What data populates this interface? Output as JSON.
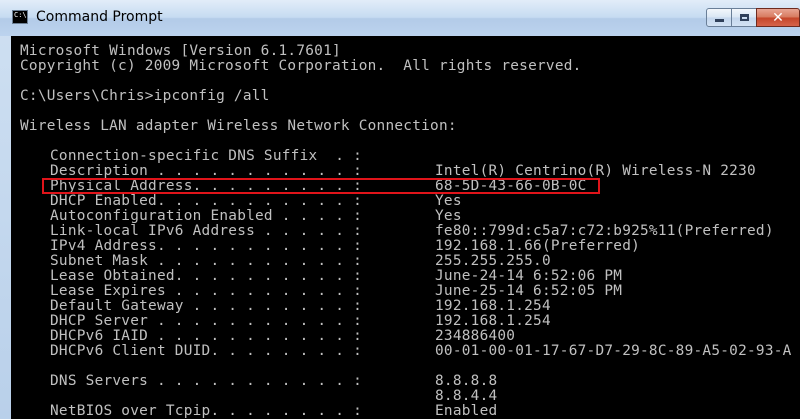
{
  "window": {
    "title": "Command Prompt",
    "app_icon_text": "C:\\"
  },
  "console": {
    "banner_line1": "Microsoft Windows [Version 6.1.7601]",
    "banner_line2": "Copyright (c) 2009 Microsoft Corporation.  All rights reserved.",
    "prompt_command": "C:\\Users\\Chris>ipconfig /all",
    "adapter_header": "Wireless LAN adapter Wireless Network Connection:",
    "entries": [
      {
        "key": "Connection-specific DNS Suffix  . :",
        "value": ""
      },
      {
        "key": "Description . . . . . . . . . . . :",
        "value": "Intel(R) Centrino(R) Wireless-N 2230"
      },
      {
        "key": "Physical Address. . . . . . . . . :",
        "value": "68-5D-43-66-0B-0C"
      },
      {
        "key": "DHCP Enabled. . . . . . . . . . . :",
        "value": "Yes"
      },
      {
        "key": "Autoconfiguration Enabled . . . . :",
        "value": "Yes"
      },
      {
        "key": "Link-local IPv6 Address . . . . . :",
        "value": "fe80::799d:c5a7:c72:b925%11(Preferred)"
      },
      {
        "key": "IPv4 Address. . . . . . . . . . . :",
        "value": "192.168.1.66(Preferred)"
      },
      {
        "key": "Subnet Mask . . . . . . . . . . . :",
        "value": "255.255.255.0"
      },
      {
        "key": "Lease Obtained. . . . . . . . . . :",
        "value": "June-24-14 6:52:06 PM"
      },
      {
        "key": "Lease Expires . . . . . . . . . . :",
        "value": "June-25-14 6:52:05 PM"
      },
      {
        "key": "Default Gateway . . . . . . . . . :",
        "value": "192.168.1.254"
      },
      {
        "key": "DHCP Server . . . . . . . . . . . :",
        "value": "192.168.1.254"
      },
      {
        "key": "DHCPv6 IAID . . . . . . . . . . . :",
        "value": "234886400"
      },
      {
        "key": "DHCPv6 Client DUID. . . . . . . . :",
        "value": "00-01-00-01-17-67-D7-29-8C-89-A5-02-93-A"
      },
      {
        "key": "DNS Servers . . . . . . . . . . . :",
        "value": "8.8.8.8"
      },
      {
        "key": "",
        "value": "8.8.4.4"
      },
      {
        "key": "NetBIOS over Tcpip. . . . . . . . :",
        "value": "Enabled"
      }
    ]
  },
  "colors": {
    "console_bg": "#000000",
    "console_text": "#c0c0c0",
    "highlight_border": "#e0141a"
  }
}
